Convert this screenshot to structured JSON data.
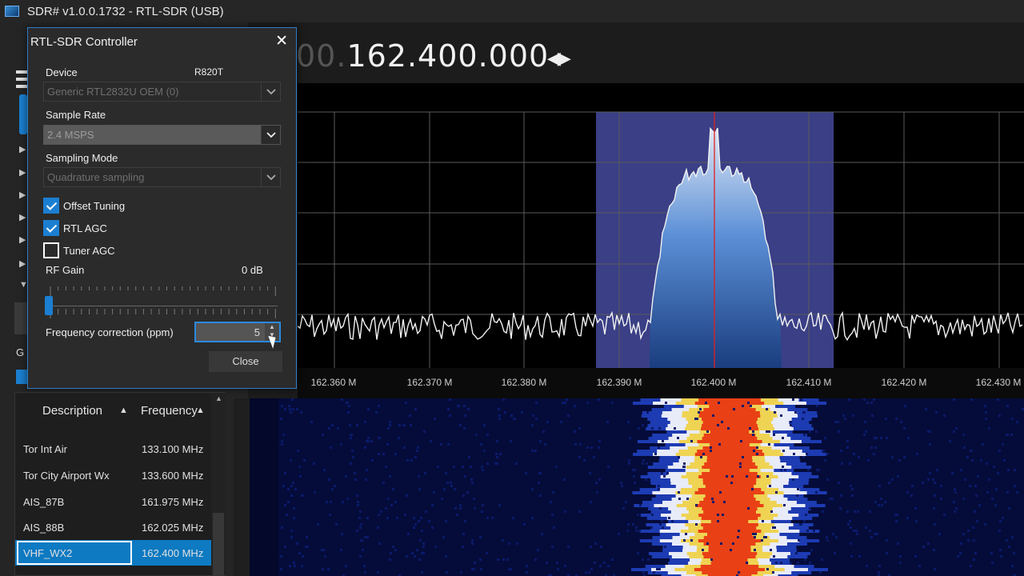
{
  "window": {
    "title": "SDR# v1.0.0.1732 - RTL-SDR (USB)"
  },
  "frequency": {
    "dim_prefix": "00.",
    "main": "162.400.000"
  },
  "axis": {
    "ticks": [
      "162.360 M",
      "162.370 M",
      "162.380 M",
      "162.390 M",
      "162.400 M",
      "162.410 M",
      "162.420 M",
      "162.430 M"
    ]
  },
  "dialog": {
    "title": "RTL-SDR Controller",
    "device_label": "Device",
    "tuner": "R820T",
    "device_value": "Generic RTL2832U OEM (0)",
    "sample_rate_label": "Sample Rate",
    "sample_rate_value": "2.4 MSPS",
    "sampling_mode_label": "Sampling Mode",
    "sampling_mode_value": "Quadrature sampling",
    "offset_tuning_label": "Offset Tuning",
    "offset_tuning_checked": true,
    "rtl_agc_label": "RTL AGC",
    "rtl_agc_checked": true,
    "tuner_agc_label": "Tuner AGC",
    "tuner_agc_checked": false,
    "rf_gain_label": "RF Gain",
    "rf_gain_value": "0 dB",
    "freq_corr_label": "Frequency correction (ppm)",
    "freq_corr_value": "5",
    "close_button": "Close"
  },
  "left_panel": {
    "partial_label": "G"
  },
  "freqlist": {
    "headers": {
      "description": "Description",
      "frequency": "Frequency"
    },
    "rows": [
      {
        "description": "Tor Int Air",
        "frequency": "133.100 MHz"
      },
      {
        "description": "Tor City Airport Wx",
        "frequency": "133.600 MHz"
      },
      {
        "description": "AIS_87B",
        "frequency": "161.975 MHz"
      },
      {
        "description": "AIS_88B",
        "frequency": "162.025 MHz"
      },
      {
        "description": "VHF_WX2",
        "frequency": "162.400 MHz",
        "selected": true
      }
    ]
  },
  "colors": {
    "accent": "#1b7fd1",
    "passband": "#3a3f86",
    "center_line": "#e02020"
  }
}
